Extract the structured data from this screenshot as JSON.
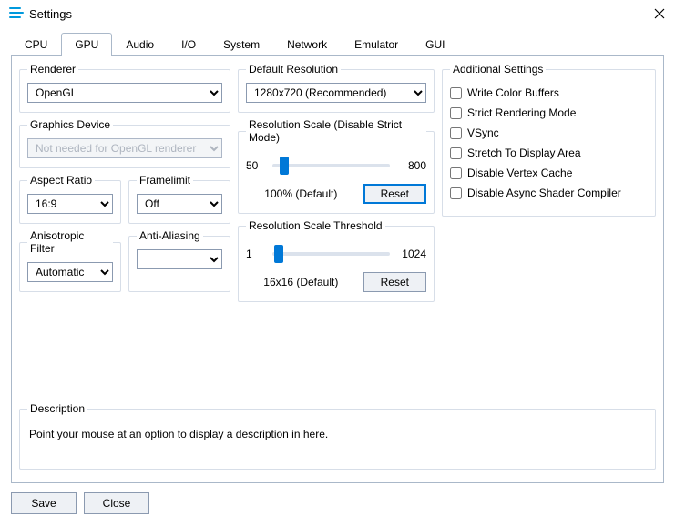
{
  "window": {
    "title": "Settings"
  },
  "tabs": {
    "cpu": "CPU",
    "gpu": "GPU",
    "audio": "Audio",
    "io": "I/O",
    "system": "System",
    "network": "Network",
    "emulator": "Emulator",
    "gui": "GUI"
  },
  "renderer": {
    "legend": "Renderer",
    "value": "OpenGL"
  },
  "graphics_device": {
    "legend": "Graphics Device",
    "value": "Not needed for OpenGL renderer"
  },
  "aspect_ratio": {
    "legend": "Aspect Ratio",
    "value": "16:9"
  },
  "framelimit": {
    "legend": "Framelimit",
    "value": "Off"
  },
  "anisotropic": {
    "legend": "Anisotropic Filter",
    "value": "Automatic"
  },
  "antialiasing": {
    "legend": "Anti-Aliasing",
    "value": ""
  },
  "default_resolution": {
    "legend": "Default Resolution",
    "value": "1280x720 (Recommended)"
  },
  "resolution_scale": {
    "legend": "Resolution Scale (Disable Strict Mode)",
    "min_label": "50",
    "max_label": "800",
    "current_label": "100% (Default)",
    "reset_label": "Reset",
    "min": 50,
    "max": 800,
    "value": 100
  },
  "resolution_threshold": {
    "legend": "Resolution Scale Threshold",
    "min_label": "1",
    "max_label": "1024",
    "current_label": "16x16 (Default)",
    "reset_label": "Reset",
    "min": 1,
    "max": 1024,
    "value": 16
  },
  "additional": {
    "legend": "Additional Settings",
    "write_color_buffers": "Write Color Buffers",
    "strict_rendering": "Strict Rendering Mode",
    "vsync": "VSync",
    "stretch": "Stretch To Display Area",
    "disable_vertex_cache": "Disable Vertex Cache",
    "disable_async_shader": "Disable Async Shader Compiler"
  },
  "description": {
    "legend": "Description",
    "text": "Point your mouse at an option to display a description in here."
  },
  "footer": {
    "save": "Save",
    "close": "Close"
  }
}
